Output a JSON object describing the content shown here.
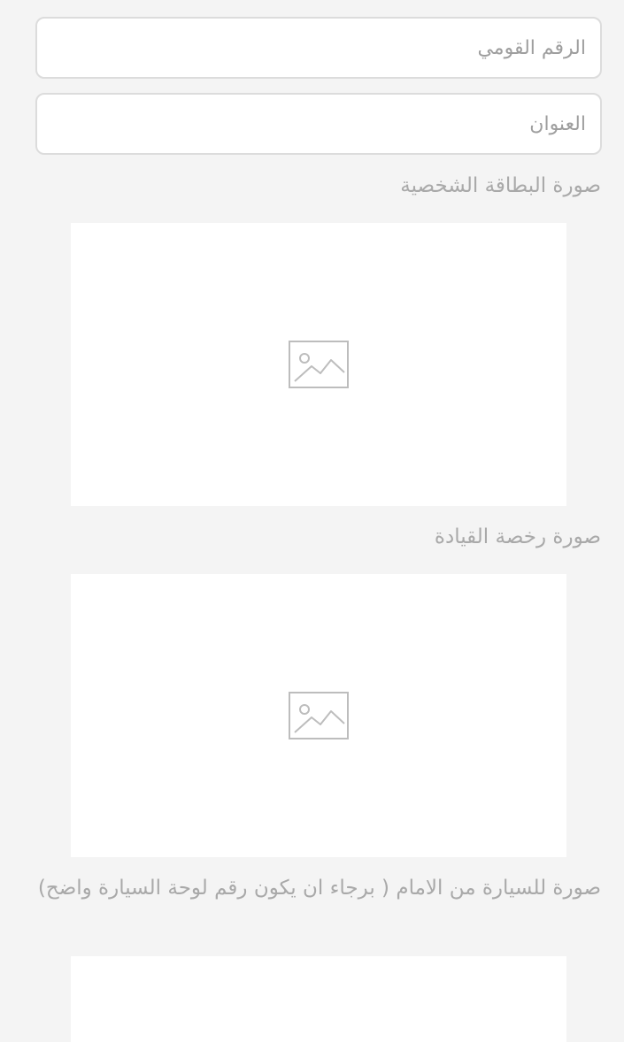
{
  "form": {
    "national_id": {
      "value": "",
      "placeholder": "الرقم القومي"
    },
    "address": {
      "value": "",
      "placeholder": "العنوان"
    },
    "id_card_photo": {
      "label": "صورة البطاقة الشخصية",
      "icon": "image-placeholder-icon"
    },
    "license_photo": {
      "label": "صورة رخصة القيادة",
      "icon": "image-placeholder-icon"
    },
    "car_front_photo": {
      "label": "صورة للسيارة من الامام ( برجاء ان يكون رقم لوحة السيارة واضح)",
      "icon": "image-placeholder-icon"
    }
  },
  "colors": {
    "page_background": "#f4f4f4",
    "field_border": "#dcdcdc",
    "label_text": "#a9a9a9",
    "icon_stroke": "#bdbdbd"
  }
}
